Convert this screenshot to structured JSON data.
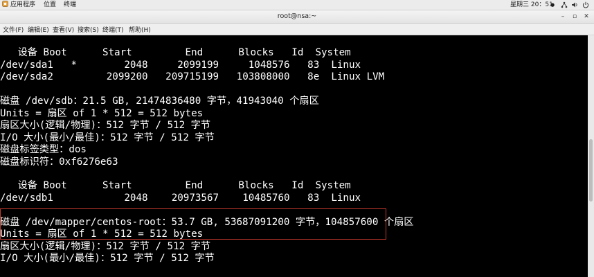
{
  "topbar": {
    "apps": "应用程序",
    "places": "位置",
    "terminal": "终端",
    "clock": "星期三 20：51",
    "clock_dot": "●"
  },
  "window": {
    "title": "root@nsa:~",
    "min": "–",
    "max": "▫",
    "close": "✕"
  },
  "menu": [
    {
      "label": "文件(F)"
    },
    {
      "label": "编辑(E)"
    },
    {
      "label": "查看(V)"
    },
    {
      "label": "搜索(S)"
    },
    {
      "label": "终端(T)"
    },
    {
      "label": "帮助(H)"
    }
  ],
  "terminal": {
    "lines": [
      "   设备 Boot      Start         End      Blocks   Id  System",
      "/dev/sda1   *        2048     2099199     1048576   83  Linux",
      "/dev/sda2         2099200   209715199   103808000   8e  Linux LVM",
      "",
      "磁盘 /dev/sdb：21.5 GB, 21474836480 字节，41943040 个扇区",
      "Units = 扇区 of 1 * 512 = 512 bytes",
      "扇区大小(逻辑/物理)：512 字节 / 512 字节",
      "I/O 大小(最小/最佳)：512 字节 / 512 字节",
      "磁盘标签类型：dos",
      "磁盘标识符：0xf6276e63",
      "",
      "   设备 Boot      Start         End      Blocks   Id  System",
      "/dev/sdb1            2048    20973567    10485760   83  Linux",
      "",
      "磁盘 /dev/mapper/centos-root：53.7 GB, 53687091200 字节，104857600 个扇区",
      "Units = 扇区 of 1 * 512 = 512 bytes",
      "扇区大小(逻辑/物理)：512 字节 / 512 字节",
      "I/O 大小(最小/最佳)：512 字节 / 512 字节"
    ]
  },
  "colors": {
    "highlight_box": "#c0392b",
    "terminal_bg": "#000000",
    "terminal_fg": "#ffffff"
  }
}
